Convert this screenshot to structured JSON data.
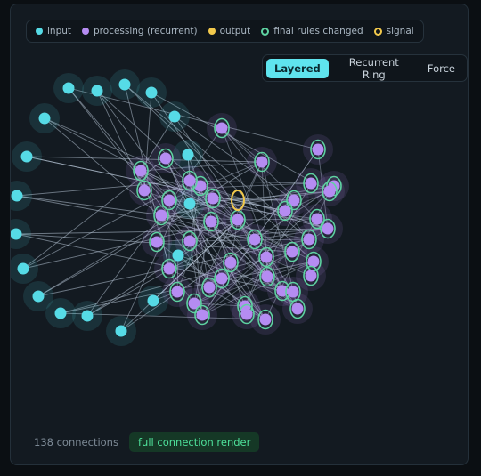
{
  "legend": {
    "items": [
      {
        "label": "input",
        "color": "#56dbe6",
        "style": "fill",
        "icon": "input-node-dot"
      },
      {
        "label": "processing (recurrent)",
        "color": "#b58cf2",
        "style": "fill",
        "icon": "processing-node-dot"
      },
      {
        "label": "output",
        "color": "#f2c94c",
        "style": "fill",
        "icon": "output-node-dot"
      },
      {
        "label": "final rules changed",
        "color": "#5ed3a2",
        "style": "ring",
        "icon": "rules-changed-ring"
      },
      {
        "label": "signal",
        "color": "#f2c94c",
        "style": "ring",
        "icon": "signal-ring"
      }
    ]
  },
  "view_modes": {
    "layered": "Layered",
    "recurrent_ring": "Recurrent Ring",
    "force": "Force",
    "active": "Layered"
  },
  "footer": {
    "connections": "138 connections",
    "render_badge": "full connection render"
  },
  "colors": {
    "input": "#56dbe6",
    "processing": "#b58cf2",
    "rules_changed_ring": "#5ed3a2",
    "signal_ring": "#f2c94c",
    "edge": "#b6c4d6"
  }
}
